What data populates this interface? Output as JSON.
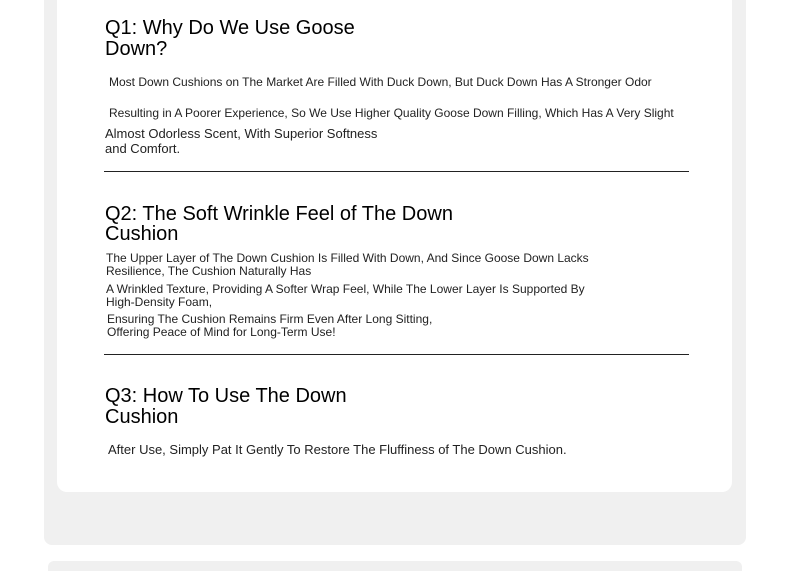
{
  "faq": {
    "q1": {
      "title": "Q1: Why Do We Use Goose Down?",
      "line1": "Most Down Cushions on The Market Are Filled With Duck Down, But Duck Down Has A Stronger Odor",
      "line2": "Resulting in A Poorer Experience, So We Use Higher Quality Goose Down Filling, Which Has A Very Slight",
      "line3": "Almost Odorless Scent, With Superior Softness and Comfort."
    },
    "q2": {
      "title": "Q2: The Soft Wrinkle Feel of The Down Cushion",
      "line1": "The Upper Layer of The Down Cushion Is Filled With Down, And Since Goose Down Lacks Resilience, The Cushion Naturally Has",
      "line2": "A Wrinkled Texture, Providing A Softer Wrap Feel, While The Lower Layer Is Supported By High-Density Foam,",
      "line3": "Ensuring The Cushion Remains Firm Even After Long Sitting, Offering Peace of Mind for Long-Term Use!"
    },
    "q3": {
      "title": "Q3: How To Use The Down Cushion",
      "line1": "After Use, Simply Pat It Gently To Restore The Fluffiness of The Down Cushion."
    }
  }
}
